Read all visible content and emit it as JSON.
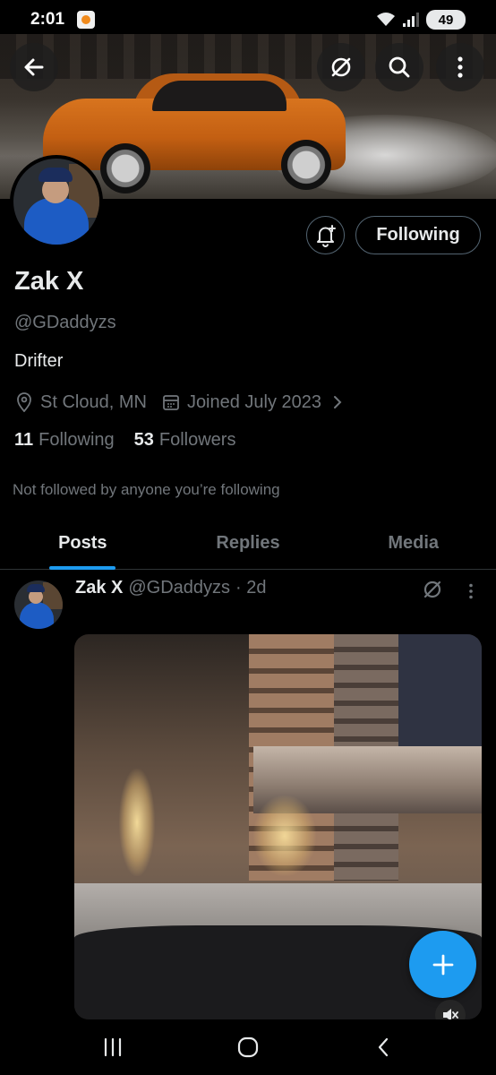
{
  "status_bar": {
    "time": "2:01",
    "battery": "49",
    "icons": [
      "notification-app-icon",
      "wifi-icon",
      "signal-icon",
      "battery-charging-icon"
    ]
  },
  "header": {
    "icons": [
      "back-arrow-icon",
      "grok-icon",
      "search-icon",
      "more-vertical-icon"
    ]
  },
  "profile": {
    "display_name": "Zak X",
    "handle": "@GDaddyzs",
    "bio": "Drifter",
    "location": "St Cloud, MN",
    "joined": "Joined July 2023",
    "following_count": "11",
    "following_label": "Following",
    "followers_count": "53",
    "followers_label": "Followers",
    "not_followed_text": "Not followed by anyone you’re following",
    "follow_button_label": "Following"
  },
  "tabs": [
    {
      "label": "Posts",
      "active": true
    },
    {
      "label": "Replies",
      "active": false
    },
    {
      "label": "Media",
      "active": false
    }
  ],
  "post": {
    "author": "Zak X",
    "handle": "@GDaddyzs",
    "time": "· 2d",
    "media_type": "video"
  },
  "colors": {
    "accent": "#1d9bf0",
    "text_primary": "#e7e9ea",
    "text_secondary": "#71767b",
    "border": "#2f3336",
    "background": "#000000"
  }
}
